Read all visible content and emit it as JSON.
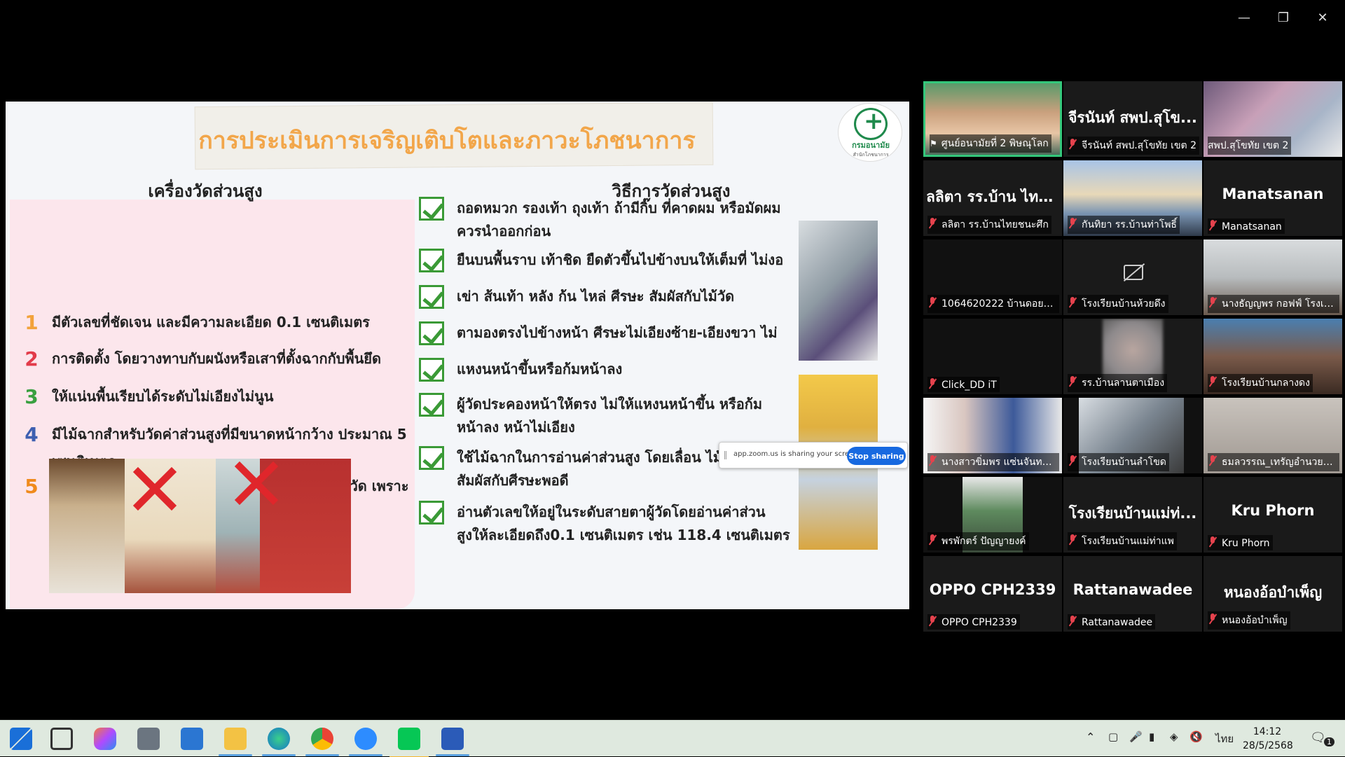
{
  "slide": {
    "title": "การประเมินการเจริญเติบโตและภาวะโภชนาการ",
    "logo_text": "กรมอนามัย",
    "logo_subtext": "สำนักโภชนาการ",
    "left_heading": "เครื่องวัดส่วนสูง",
    "right_heading": "วิธีการวัดส่วนสูง",
    "left_items": [
      {
        "num": "1",
        "color": "#f2a23a",
        "text": "มีตัวเลขที่ชัดเจน และมีความละเอียด 0.1 เซนติเมตร"
      },
      {
        "num": "2",
        "color": "#e23b4a",
        "text": "การติดตั้ง โดยวางทาบกับผนังหรือเสาที่ตั้งฉากกับพื้นยึด"
      },
      {
        "num": "3",
        "color": "#3aa040",
        "text": "ให้แน่นพื้นเรียบได้ระดับไม่เอียงไม่นูน"
      },
      {
        "num": "4",
        "color": "#3d5fb0",
        "text": "มีไม้ฉากสำหรับวัดค่าส่วนสูงที่มีขนาดหน้ากว้าง ประมาณ 5 เซนติเมตร"
      },
      {
        "num": "5",
        "color": "#f08a1c",
        "text": "ไม่ควรใช้ไม้บรรทัด สมุด หรือกระดาษแข็ง ในการวัด เพราะจะทำให้อ่านค่าไม่ถูกต้อง"
      }
    ],
    "right_items": [
      {
        "line1": "ถอดหมวก รองเท้า ถุงเท้า ถ้ามีกิ๊บ ที่คาดผม หรือมัดผม",
        "line2": "ควรนำออกก่อน"
      },
      {
        "line1": "ยืนบนพื้นราบ เท้าชิด ยืดตัวขึ้นไปข้างบนให้เต็มที่ ไม่งอ",
        "line2": ""
      },
      {
        "line1": "เข่า ส้นเท้า หลัง ก้น ไหล่ ศีรษะ สัมผัสกับไม้วัด",
        "line2": ""
      },
      {
        "line1": "ตามองตรงไปข้างหน้า ศีรษะไม่เอียงซ้าย-เอียงขวา ไม่",
        "line2": ""
      },
      {
        "line1": "แหงนหน้าขึ้นหรือก้มหน้าลง",
        "line2": ""
      },
      {
        "line1": "ผู้วัดประคองหน้าให้ตรง ไม่ให้แหงนหน้าขึ้น หรือก้ม",
        "line2": "หน้าลง หน้าไม่เอียง"
      },
      {
        "line1": "ใช้ไม้ฉากในการอ่านค่าส่วนสูง โดยเลื่อน ไม้",
        "line2": "สัมผัสกับศีรษะพอดี"
      },
      {
        "line1": "อ่านตัวเลขให้อยู่ในระดับสายตาผู้วัดโดยอ่านค่าส่วน",
        "line2": "สูงให้ละเอียดถึง0.1 เซนติเมตร  เช่น 118.4 เซนติเมตร"
      }
    ]
  },
  "share_bar": {
    "text": "app.zoom.us is sharing your screen.",
    "stop_label": "Stop sharing"
  },
  "gallery": [
    {
      "label": "ศูนย์อนามัยที่ 2 พิษณุโลก",
      "big": "",
      "icon": "pin",
      "video": "face"
    },
    {
      "label": "จีรนันท์ สพป.สุโขทัย เขต 2",
      "big": "จีรนันท์ สพป.สุโข...",
      "icon": "mic-off",
      "video": "none"
    },
    {
      "label": "สพป.สุโขทัย เขต 2",
      "big": "",
      "icon": "none",
      "video": "room"
    },
    {
      "label": "ลลิตา รร.บ้านไทยชนะศึก",
      "big": "ลลิตา รร.บ้าน ไทย...",
      "icon": "mic-off",
      "video": "none"
    },
    {
      "label": "กันทิยา รร.บ้านท่าโพธิ์",
      "big": "",
      "icon": "mic-off",
      "video": "avatar"
    },
    {
      "label": "Manatsanan",
      "big": "Manatsanan",
      "icon": "mic-off",
      "video": "none"
    },
    {
      "label": "1064620222 บ้านดอยไก่...",
      "big": "",
      "icon": "mic-off",
      "video": "black"
    },
    {
      "label": "โรงเรียนบ้านห้วยดึง",
      "big": "",
      "icon": "mic-off",
      "video": "cam-off"
    },
    {
      "label": "นางธัญญพร กอฟฟ์ โรงเรี...",
      "big": "",
      "icon": "mic-off",
      "video": "office"
    },
    {
      "label": "Click_DD iT",
      "big": "",
      "icon": "mic-off",
      "video": "black"
    },
    {
      "label": "รร.บ้านลานตาเมือง",
      "big": "",
      "icon": "mic-off",
      "video": "blur"
    },
    {
      "label": "โรงเรียนบ้านกลางดง",
      "big": "",
      "icon": "mic-off",
      "video": "face2"
    },
    {
      "label": "นางสาวขิ่มพร แซ่นจันทร์...",
      "big": "",
      "icon": "mic-off",
      "video": "class"
    },
    {
      "label": "โรงเรียนบ้านลำโขด",
      "big": "",
      "icon": "mic-off",
      "video": "ceiling"
    },
    {
      "label": "ธมลวรรณ_เทรัญอำนวยวิทย์",
      "big": "",
      "icon": "mic-off",
      "video": "grey"
    },
    {
      "label": "พรพักตร์ ปัญญายงค์",
      "big": "",
      "icon": "mic-off",
      "video": "building"
    },
    {
      "label": "โรงเรียนบ้านแม่ท่าแพ",
      "big": "โรงเรียนบ้านแม่ท่...",
      "icon": "mic-off",
      "video": "none"
    },
    {
      "label": "Kru Phorn",
      "big": "Kru Phorn",
      "icon": "mic-off",
      "video": "none"
    },
    {
      "label": "OPPO CPH2339",
      "big": "OPPO CPH2339",
      "icon": "mic-off",
      "video": "none"
    },
    {
      "label": "Rattanawadee",
      "big": "Rattanawadee",
      "icon": "mic-off",
      "video": "none"
    },
    {
      "label": "หนองอ้อบำเพ็ญ",
      "big": "หนองอ้อบำเพ็ญ",
      "icon": "mic-off",
      "video": "none"
    }
  ],
  "taskbar": {
    "apps": [
      "start-icon",
      "task-view-icon",
      "copilot-icon",
      "calculator-icon",
      "snipping-tool-icon",
      "file-explorer-icon",
      "edge-icon",
      "chrome-icon",
      "zoom-icon",
      "line-icon",
      "word-icon"
    ],
    "lang": "ไทย",
    "time": "14:12",
    "date": "28/5/2568",
    "notification_count": "1"
  }
}
